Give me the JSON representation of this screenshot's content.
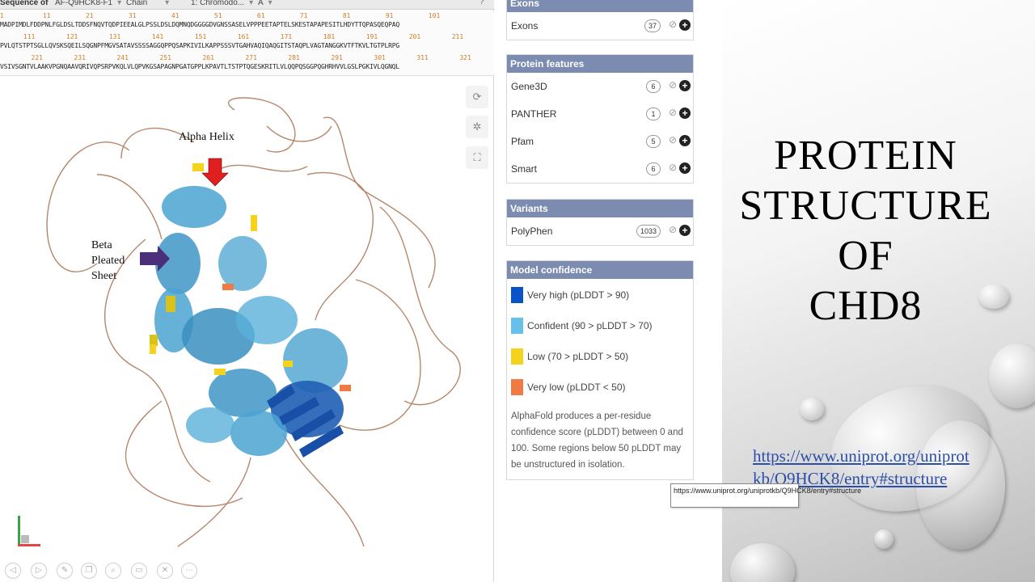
{
  "sequence_toolbar": {
    "label": "Sequence of",
    "entry_select": "AF-Q9HCK8-F1",
    "type_select": "Chain",
    "domain_select": "1: Chromodo...",
    "chain_select": "A",
    "help": "?"
  },
  "sequence": {
    "lines": [
      {
        "numbers": "1          11         21         31         41         51         61         71         81         91         101",
        "residues": "MADPIMDLFDDPNLFGLDSLTDDSFNQVTQDPIEEALGLPSSLDSLDQMNQDGGGGDVGNSSASELVPPPEETAPTELSKESTAPAPESITLHDYTTQPASQEQPAQ"
      },
      {
        "numbers": "      111        121        131        141        151        161        171        181        191        201        211",
        "residues": "PVLQTSTPTSGLLQVSKSQEILSQGNPFMGVSATAVSSSSAGGQPPQSAPKIVILKAPPSSSVTGAHVAQIQAQGITSTAQPLVAGTANGGKVTFTKVLTGTPLRPG"
      },
      {
        "numbers": "        221        231        241        251        261        271        281        291        301        311        321",
        "residues": "VSIVSGNTVLAAKVPGNQAAVQRIVQPSRPVKQLVLQPVKGSAPAGNPGATGPPLKPAVTLTSTPTQGESKRITLVLQQPQSGGPQGHRHVVLGSLPGKIVLQGNQL"
      }
    ]
  },
  "viewer_tools": {
    "reset_icon": "reset-icon",
    "settings_icon": "settings-icon",
    "expand_icon": "expand-icon"
  },
  "annotations": {
    "alpha_helix": "Alpha Helix",
    "beta_sheet_line1": "Beta",
    "beta_sheet_line2": "Pleated",
    "beta_sheet_line3": "Sheet",
    "arrow_alpha_color": "#e02020",
    "arrow_beta_color": "#4b2f7a"
  },
  "panel": {
    "exons": {
      "header": "Exons",
      "rows": [
        {
          "name": "Exons",
          "count": "37"
        }
      ]
    },
    "protein_features": {
      "header": "Protein features",
      "rows": [
        {
          "name": "Gene3D",
          "count": "6"
        },
        {
          "name": "PANTHER",
          "count": "1"
        },
        {
          "name": "Pfam",
          "count": "5"
        },
        {
          "name": "Smart",
          "count": "6"
        }
      ]
    },
    "variants": {
      "header": "Variants",
      "rows": [
        {
          "name": "PolyPhen",
          "count": "1033"
        }
      ]
    },
    "model_confidence": {
      "header": "Model confidence",
      "items": [
        {
          "label": "Very high (pLDDT > 90)",
          "color": "#0a53c7"
        },
        {
          "label": "Confident (90 > pLDDT > 70)",
          "color": "#66c1ea"
        },
        {
          "label": "Low (70 > pLDDT > 50)",
          "color": "#f5d31c"
        },
        {
          "label": "Very low (pLDDT < 50)",
          "color": "#f07a44"
        }
      ],
      "note": "AlphaFold produces a per-residue confidence score (pLDDT) between 0 and 100. Some regions below 50 pLDDT may be unstructured in isolation."
    }
  },
  "tooltip": "https://www.uniprot.org/uniprotkb/Q9HCK8/entry#structure",
  "slide": {
    "title_line1": "PROTEIN",
    "title_line2": "STRUCTURE",
    "title_line3": "OF",
    "title_line4": "CHD8",
    "link": "https://www.uniprot.org/uniprotkb/Q9HCK8/entry#structure"
  }
}
